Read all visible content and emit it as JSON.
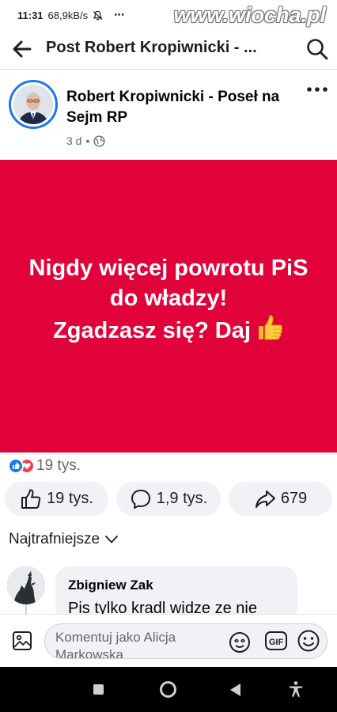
{
  "status_bar": {
    "time": "11:31",
    "speed": "68,9kB/s",
    "more": "⋯",
    "watermark": "www.wiocha.pl"
  },
  "header": {
    "title": "Post Robert Kropiwnicki - ..."
  },
  "post": {
    "author": "Robert Kropiwnicki - Poseł na Sejm RP",
    "time": "3 d",
    "separator": "•",
    "image_text_lines": [
      "Nigdy więcej powrotu PiS",
      "do władzy!",
      "Zgadzasz się? Daj"
    ],
    "image_emoji": "thumbs-up",
    "image_background": "#e1023a"
  },
  "reactions": {
    "summary_count": "19 tys."
  },
  "actions": {
    "like": "19 tys.",
    "comment": "1,9 tys.",
    "share": "679"
  },
  "comments": {
    "sort_label": "Najtrafniejsze",
    "items": [
      {
        "author": "Zbigniew Zak",
        "text": "Pis tylko kradl widze ze nie"
      }
    ]
  },
  "composer": {
    "placeholder": "Komentuj jako Alicja Markowska"
  },
  "colors": {
    "brand": "#1877f2",
    "love": "#f33e58",
    "image_red": "#e1023a"
  }
}
